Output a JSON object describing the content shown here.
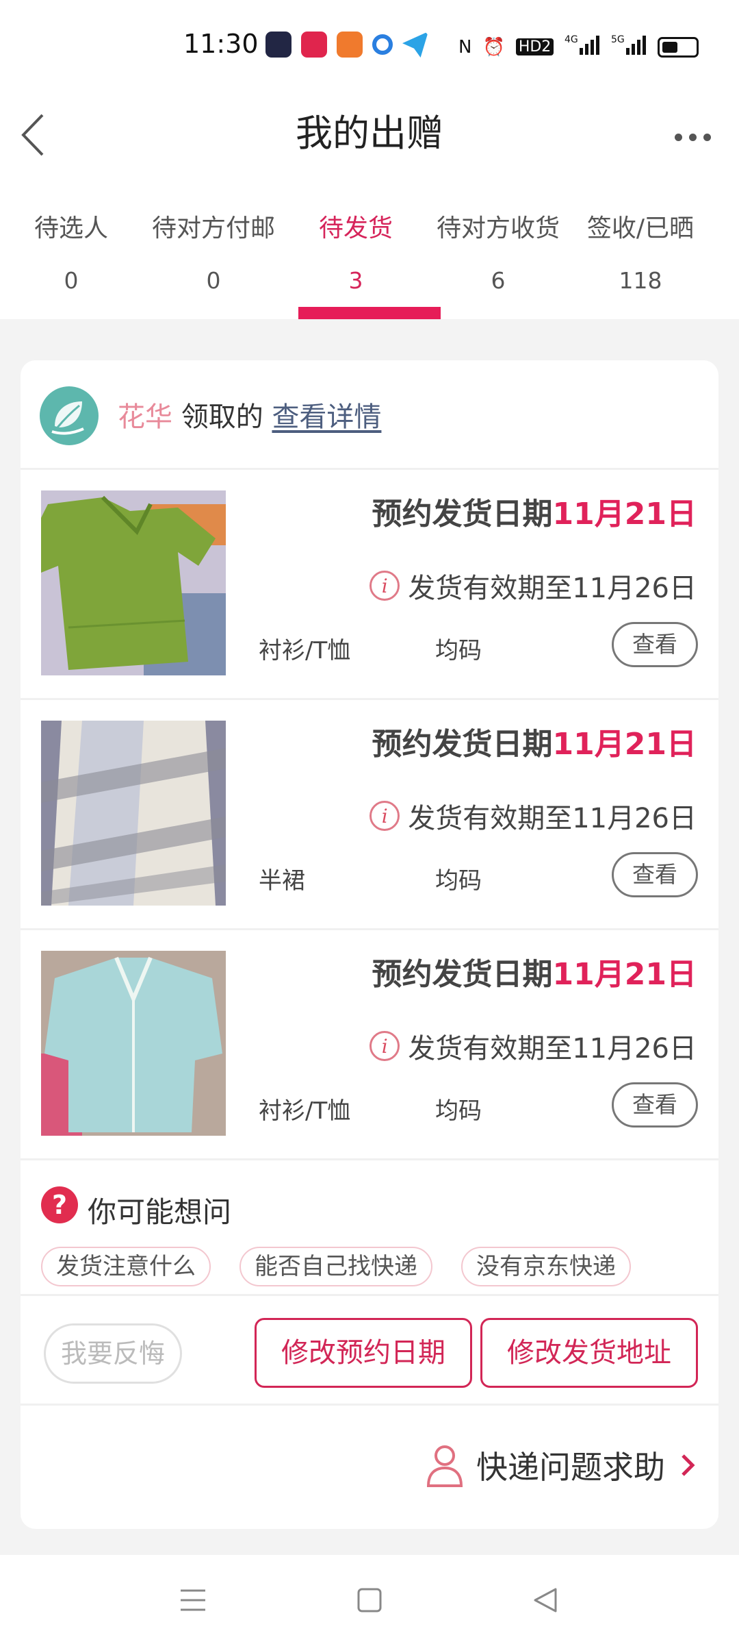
{
  "status_bar": {
    "time": "11:30",
    "app_icons": [
      "#222644",
      "#e0254d",
      "#f07a2d",
      "#2a7fe0",
      "#2ba3e6"
    ],
    "indicators": [
      "N",
      "⏰",
      "HD2",
      "4G",
      "5G"
    ]
  },
  "header": {
    "title": "我的出赠"
  },
  "tabs": [
    {
      "label": "待选人",
      "count": "0"
    },
    {
      "label": "待对方付邮",
      "count": "0"
    },
    {
      "label": "待发货",
      "count": "3"
    },
    {
      "label": "待对方收货",
      "count": "6"
    },
    {
      "label": "签收/已晒",
      "count": "118"
    }
  ],
  "active_tab": 2,
  "receiver": {
    "name": "花华",
    "action": "领取的",
    "details_link": "查看详情"
  },
  "items": [
    {
      "ship_label": "预约发货日期",
      "ship_date": "11月21日",
      "validity": "发货有效期至11月26日",
      "category": "衬衫/T恤",
      "size": "均码",
      "view_label": "查看"
    },
    {
      "ship_label": "预约发货日期",
      "ship_date": "11月21日",
      "validity": "发货有效期至11月26日",
      "category": "半裙",
      "size": "均码",
      "view_label": "查看"
    },
    {
      "ship_label": "预约发货日期",
      "ship_date": "11月21日",
      "validity": "发货有效期至11月26日",
      "category": "衬衫/T恤",
      "size": "均码",
      "view_label": "查看"
    }
  ],
  "faq": {
    "title": "你可能想问",
    "chips": [
      "发货注意什么",
      "能否自己找快递",
      "没有京东快递"
    ]
  },
  "actions": {
    "regret": "我要反悔",
    "change_date": "修改预约日期",
    "change_address": "修改发货地址"
  },
  "help": {
    "label": "快递问题求助"
  },
  "colors": {
    "accent": "#e61d58",
    "link": "#4d5e7f"
  }
}
